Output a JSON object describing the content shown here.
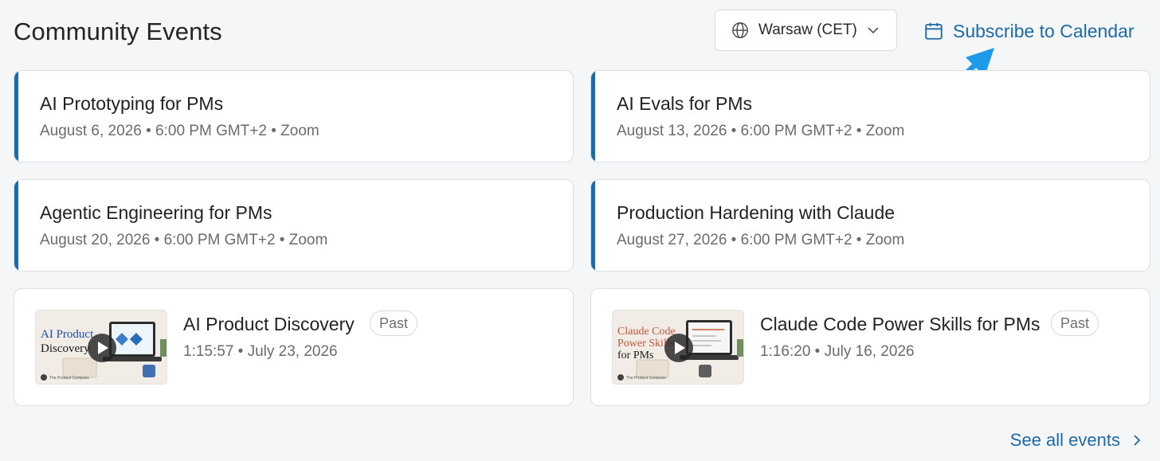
{
  "header": {
    "title": "Community Events",
    "timezone": "Warsaw (CET)",
    "subscribe_label": "Subscribe to Calendar"
  },
  "upcoming_events": [
    {
      "title": "AI Prototyping for PMs",
      "meta": "August 6, 2026 • 6:00 PM GMT+2 • Zoom"
    },
    {
      "title": "AI Evals for PMs",
      "meta": "August 13, 2026 • 6:00 PM GMT+2 • Zoom"
    },
    {
      "title": "Agentic Engineering for PMs",
      "meta": "August 20, 2026 • 6:00 PM GMT+2 • Zoom"
    },
    {
      "title": "Production Hardening with Claude",
      "meta": "August 27, 2026 • 6:00 PM GMT+2 • Zoom"
    }
  ],
  "past_events": [
    {
      "title": "AI Product Discovery",
      "badge": "Past",
      "meta": "1:15:57 • July 23, 2026",
      "thumb_lines": [
        "AI Product",
        "Discovery"
      ],
      "thumb_color": "#1f4fa0",
      "thumb_footer": "The Product Compass"
    },
    {
      "title": "Claude Code Power Skills for PMs",
      "badge": "Past",
      "meta": "1:16:20 • July 16, 2026",
      "thumb_lines": [
        "Claude Code",
        "Power Skills",
        "for PMs"
      ],
      "thumb_color": "#c4553a",
      "thumb_footer": "The Product Compass"
    }
  ],
  "footer": {
    "see_all_label": "See all events"
  },
  "colors": {
    "accent": "#1f6aa5",
    "link": "#1c6aa6",
    "annotation_arrow": "#1e9be8"
  }
}
